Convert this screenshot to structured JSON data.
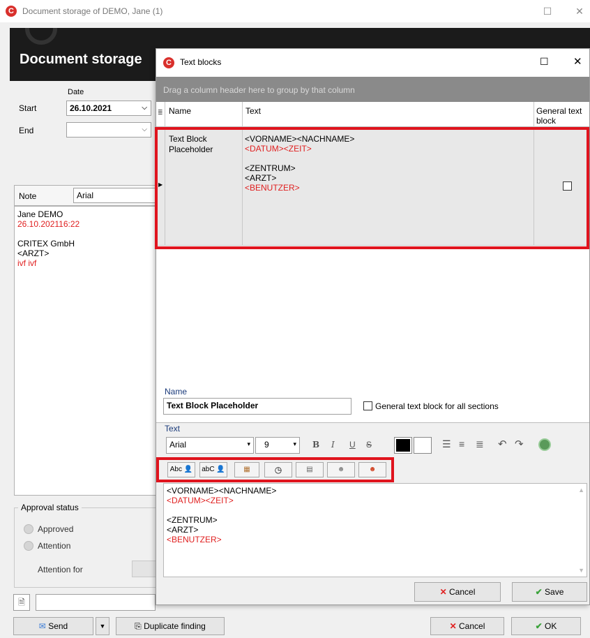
{
  "window": {
    "title": "Document storage of DEMO, Jane (1)",
    "header": "Document storage"
  },
  "dates": {
    "date_label": "Date",
    "start_label": "Start",
    "start_value": "26.10.2021",
    "end_label": "End",
    "end_value": ""
  },
  "note": {
    "label": "Note",
    "font": "Arial",
    "lines": [
      {
        "text": "Jane DEMO",
        "red": false
      },
      {
        "text": "26.10.202116:22",
        "red": true
      },
      {
        "text": "",
        "red": false
      },
      {
        "text": "CRITEX GmbH",
        "red": false
      },
      {
        "text": "<ARZT>",
        "red": false
      },
      {
        "text": "ivf ivf",
        "red": true
      }
    ]
  },
  "approval": {
    "title": "Approval status",
    "approved": "Approved",
    "attention": "Attention",
    "attention_for": "Attention for"
  },
  "bottom": {
    "send": "Send",
    "duplicate": "Duplicate finding",
    "cancel": "Cancel",
    "ok": "OK"
  },
  "dialog": {
    "title": "Text blocks",
    "group_hint": "Drag a column header here to group by that column",
    "columns": {
      "name": "Name",
      "text": "Text",
      "general": "General text block"
    },
    "row": {
      "name": "Text Block Placeholder",
      "text_lines": [
        {
          "text": "<VORNAME><NACHNAME>",
          "red": false
        },
        {
          "text": "<DATUM><ZEIT>",
          "red": true
        },
        {
          "text": "",
          "red": false
        },
        {
          "text": "<ZENTRUM>",
          "red": false
        },
        {
          "text": "<ARZT>",
          "red": false
        },
        {
          "text": "<BENUTZER>",
          "red": true
        }
      ],
      "general_checked": false
    },
    "name_label": "Name",
    "name_value": "Text Block Placeholder",
    "general_all_label": "General text block for all sections",
    "text_label": "Text",
    "font": "Arial",
    "font_size": "9",
    "placeholder_buttons": [
      "Abc",
      "abC"
    ],
    "editor_lines": [
      {
        "text": "<VORNAME><NACHNAME>",
        "red": false
      },
      {
        "text": "<DATUM><ZEIT>",
        "red": true
      },
      {
        "text": "",
        "red": false
      },
      {
        "text": "<ZENTRUM>",
        "red": false
      },
      {
        "text": "<ARZT>",
        "red": false
      },
      {
        "text": "<BENUTZER>",
        "red": true
      }
    ],
    "cancel": "Cancel",
    "save": "Save"
  },
  "colors": {
    "highlight": "#e0141e",
    "placeholder_red": "#e02020",
    "header_bg": "#1b1b1b"
  }
}
